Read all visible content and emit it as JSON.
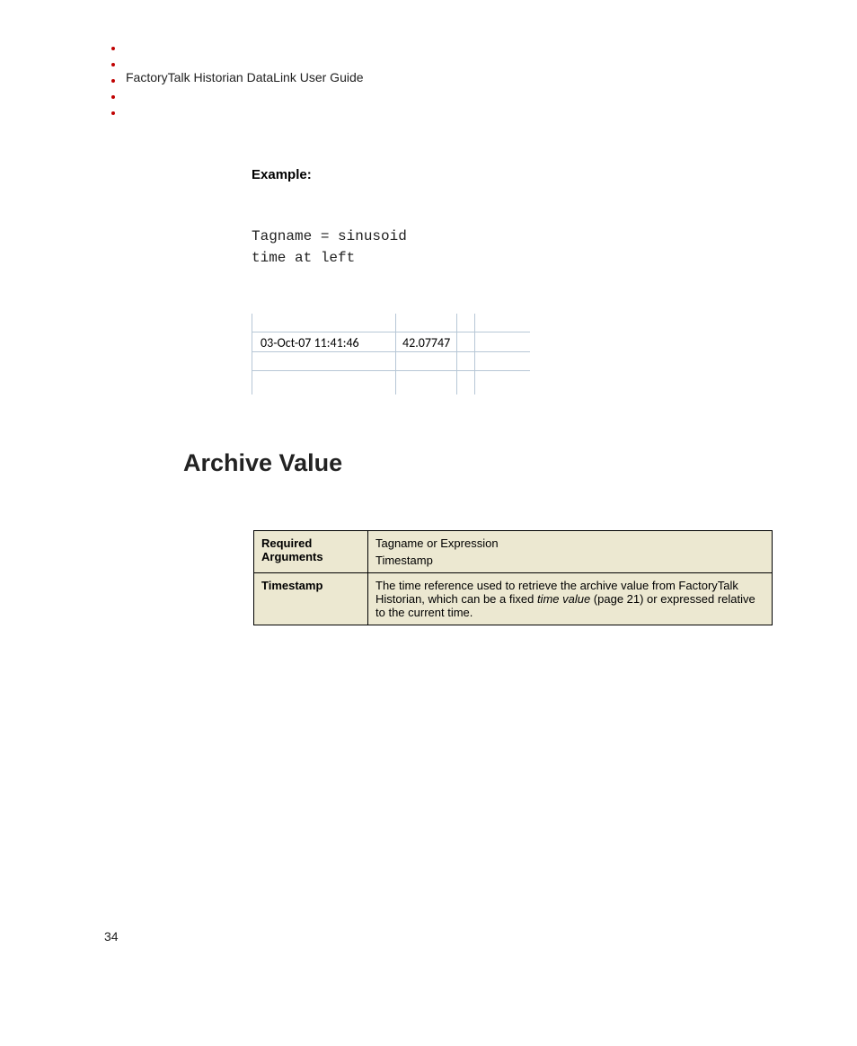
{
  "header": "FactoryTalk Historian DataLink User Guide",
  "example_label": "Example:",
  "code": {
    "line1": "Tagname = sinusoid",
    "line2": "time at left"
  },
  "grid": {
    "timestamp": "03-Oct-07 11:41:46",
    "value": "42.07747"
  },
  "section_title": "Archive Value",
  "table": {
    "row1": {
      "label": "Required Arguments",
      "v1": "Tagname or Expression",
      "v2": "Timestamp"
    },
    "row2": {
      "label": "Timestamp",
      "desc_pre": "The time reference used to retrieve the archive value from FactoryTalk Historian, which can be a fixed ",
      "desc_em": "time value",
      "desc_mid": " (page 21) or expressed relative to the current time."
    }
  },
  "page_number": "34"
}
